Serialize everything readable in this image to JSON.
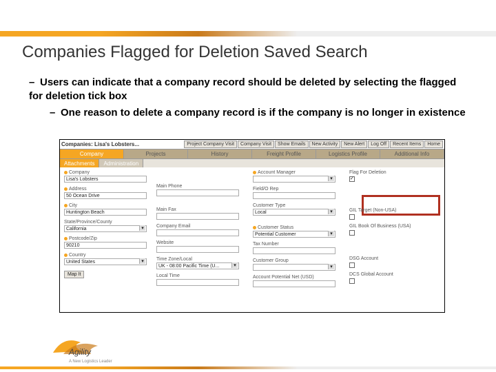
{
  "title": "Companies Flagged for Deletion Saved Search",
  "bullet1": "Users can indicate that a company record should be deleted by selecting the flagged for deletion tick box",
  "bullet2": "One reason to delete a company record is if the company is no longer in existence",
  "crumb": "Companies: Lisa's Lobsters...",
  "topbtns": [
    "Project Company Visit",
    "Company Visit",
    "Show Emails",
    "New Activity",
    "New Alert",
    "Log Off",
    "Recent Items",
    "Home"
  ],
  "tabs": [
    "Company",
    "Projects",
    "History",
    "Freight Profile",
    "Logistics Profile",
    "Additional Info"
  ],
  "subtabs": [
    "Attachments",
    "Administration"
  ],
  "col1": {
    "company": {
      "lbl": "Company",
      "val": "Lisa's Lobsters"
    },
    "address": {
      "lbl": "Address",
      "val": "50 Ocean Drive"
    },
    "city": {
      "lbl": "City",
      "val": "Huntington Beach"
    },
    "state": {
      "lbl": "State/Province/County",
      "val": "California"
    },
    "postcode": {
      "lbl": "Postcode/Zip",
      "val": "90210"
    },
    "country": {
      "lbl": "Country",
      "val": "United States"
    },
    "map": "Map It"
  },
  "col2": {
    "mainphone": {
      "lbl": "Main Phone",
      "val": ""
    },
    "mainfax": {
      "lbl": "Main Fax",
      "val": ""
    },
    "email": {
      "lbl": "Company Email",
      "val": ""
    },
    "website": {
      "lbl": "Website",
      "val": ""
    },
    "timezone": {
      "lbl": "Time Zone/Local",
      "val": "UK - 08:00 Pacific Time (U..."
    },
    "localtime": {
      "lbl": "Local Time",
      "val": ""
    }
  },
  "col3": {
    "acctmgr": {
      "lbl": "Account Manager",
      "val": ""
    },
    "fieldrep": {
      "lbl": "Field/O Rep",
      "val": ""
    },
    "custtype": {
      "lbl": "Customer Type",
      "val": "Local"
    },
    "custstatus": {
      "lbl": "Customer Status",
      "val": "Potential Customer"
    },
    "taxnum": {
      "lbl": "Tax Number",
      "val": ""
    },
    "custgroup": {
      "lbl": "Customer Group",
      "val": ""
    },
    "acctpotential": {
      "lbl": "Account Potential Net (USD)",
      "val": ""
    }
  },
  "col4": {
    "flag": {
      "lbl": "Flag For Deletion"
    },
    "giltarget": {
      "lbl": "GIL Target (Non-USA)"
    },
    "gilbob": {
      "lbl": "GIL Book Of Business (USA)"
    },
    "dsgacct": {
      "lbl": "DSG Account"
    },
    "dcsglobal": {
      "lbl": "DCS Global Account"
    }
  },
  "logo": {
    "name": "Agility",
    "tag": "A New Logistics Leader"
  }
}
